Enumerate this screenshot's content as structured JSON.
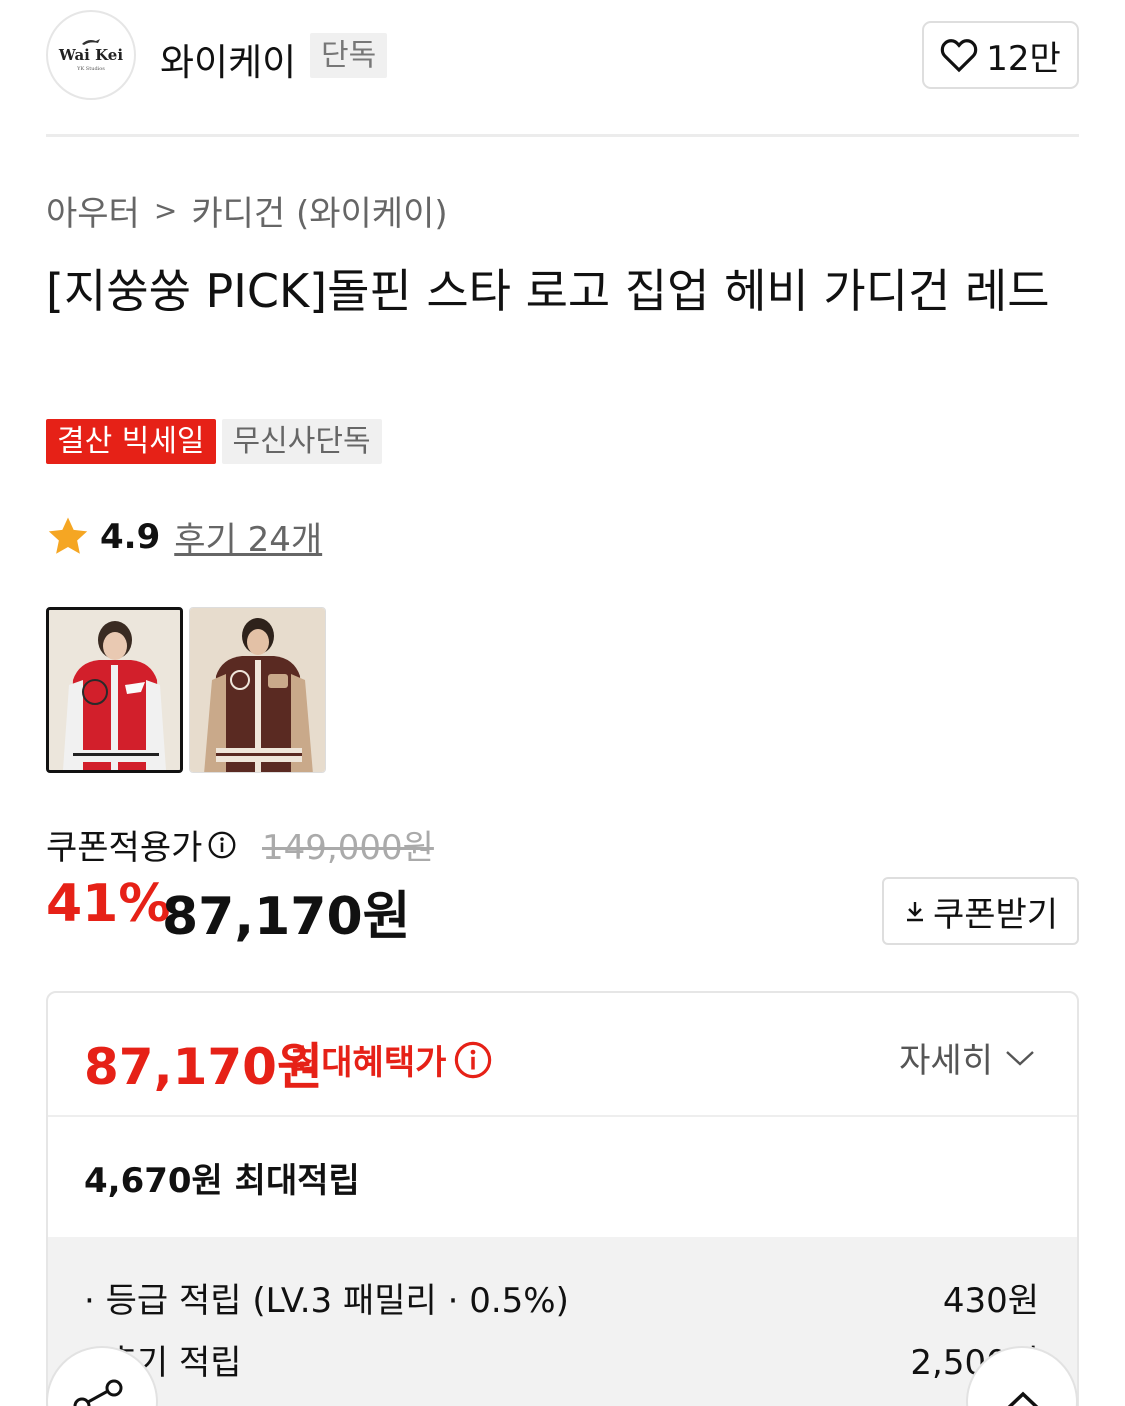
{
  "brand": {
    "logo_text": "Wai Kei",
    "logo_subtext": "YK Studios",
    "name": "와이케이",
    "badge": "단독"
  },
  "like": {
    "count": "12만",
    "icon": "heart-outline-icon"
  },
  "breadcrumb": {
    "category": "아우터",
    "separator": ">",
    "subcategory": "카디건 (와이케이)"
  },
  "product": {
    "title": "[지쑹쑹 PICK]돌핀 스타 로고 집업 헤비 가디건 레드",
    "tags": [
      "결산 빅세일",
      "무신사단독"
    ]
  },
  "rating": {
    "score": "4.9",
    "review_link": "후기 24개",
    "icon": "star-icon",
    "star_color": "#f5a623"
  },
  "thumbnails": [
    {
      "label": "red cardigan thumbnail",
      "selected": true
    },
    {
      "label": "brown cardigan thumbnail",
      "selected": false
    }
  ],
  "price": {
    "coupon_label": "쿠폰적용가",
    "original": "149,000원",
    "discount": "41%",
    "final": "87,170원",
    "coupon_button": "쿠폰받기",
    "accent_color": "#e62117"
  },
  "benefit": {
    "price": "87,170원",
    "label": "최대혜택가",
    "details_button": "자세히",
    "points_summary": "4,670원 최대적립",
    "points_detail": [
      {
        "label": "· 등급 적립 (LV.3 패밀리 · 0.5%)",
        "value": "430원"
      },
      {
        "label": "· 후기 적립",
        "value": "2,500원"
      }
    ]
  },
  "fabs": {
    "share_icon": "share-icon",
    "top_icon": "chevron-up-icon"
  }
}
